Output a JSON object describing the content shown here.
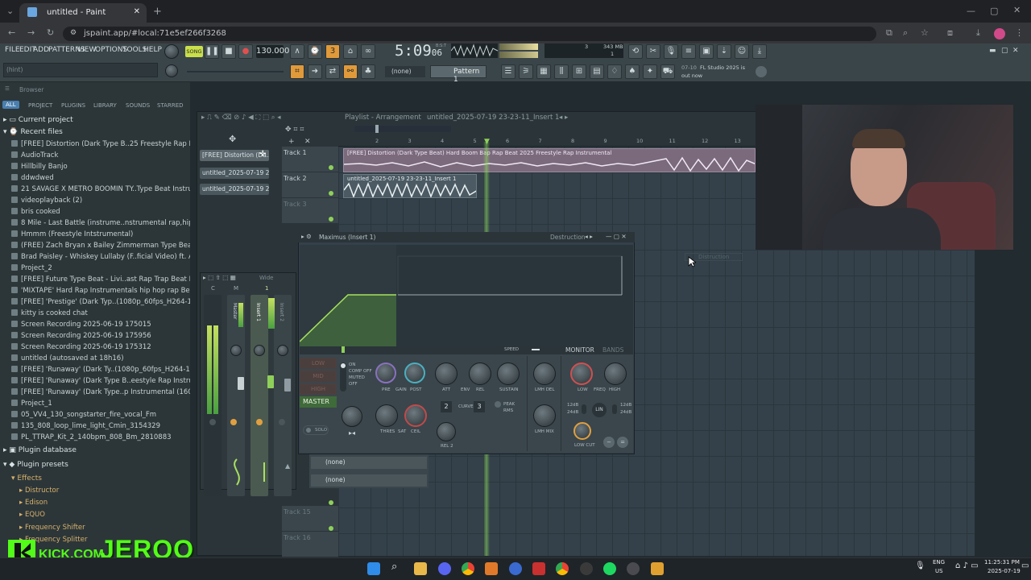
{
  "browser_tab": {
    "title": "untitled - Paint",
    "close": "✕",
    "new": "+"
  },
  "address": {
    "url": "jspaint.app/#local:71e5ef266f3268"
  },
  "menu": [
    "FILE",
    "EDIT",
    "ADD",
    "PATTERNS",
    "VIEW",
    "OPTIONS",
    "TOOLS",
    "HELP"
  ],
  "transport": {
    "song_label": "SONG",
    "tempo": "130.000",
    "time_main": "5:09",
    "time_sub": "06",
    "time_unit": "B:S:T",
    "cpu": "3",
    "mem": "343 MB",
    "voices": "1"
  },
  "hint": {
    "text": "(hint)",
    "news_date": "07-10",
    "news_text": "FL Studio 2025 is",
    "news_text2": "out now"
  },
  "pattern": {
    "selector": "(none)",
    "name": "Pattern 1"
  },
  "sidebar": {
    "browser_label": "Browser",
    "tabs": [
      "ALL",
      "PROJECT",
      "PLUGINS",
      "LIBRARY",
      "SOUNDS",
      "STARRED"
    ],
    "current_project": "Current project",
    "recent_files": "Recent files",
    "files": [
      "[FREE] Distortion (Dark Type B..25 Freestyle Rap Instrumental",
      "AudioTrack",
      "Hillbilly Banjo",
      "ddwdwed",
      "21 SAVAGE X METRO BOOMIN TY..Type Beat Instrumental 2025",
      "videoplayback (2)",
      "bris cooked",
      "8 Mile - Last Battle (instrume..nstrumental rap,hip hop beats)",
      "Hmmm (Freestyle Intstrumental)",
      "(FREE) Zach Bryan x Bailey Zimmerman Type Beat Too Late",
      "Brad Paisley - Whiskey Lullaby (F..ficial Video) ft. Alison Krauss",
      "Project_2",
      "[FREE] Future Type Beat - Livi..ast Rap Trap Beat Instrumental",
      "'MIXTAPE' Hard Rap Instrumentals  hip hop rap Beats [MIX]",
      "[FREE] 'Prestige' (Dark Typ..(1080p_60fps_H264-128kbit_AAC)",
      "kitty is cooked chat",
      "Screen Recording 2025-06-19 175015",
      "Screen Recording 2025-06-19 175956",
      "Screen Recording 2025-06-19 175312",
      "untitled (autosaved at 18h16)",
      "[FREE] 'Runaway' (Dark Ty..(1080p_60fps_H264-128kbit_AAC)",
      "[FREE] 'Runaway' (Dark Type B..eestyle Rap Instrumental (BQ)",
      "[FREE] 'Runaway' (Dark Type..p Instrumental (160kbit_Opus)",
      "Project_1",
      "05_VV4_130_songstarter_fire_vocal_Fm",
      "135_808_loop_lime_light_Cmin_3154329",
      "PL_TTRAP_Kit_2_140bpm_808_Bm_2810883"
    ],
    "plugin_database": "Plugin database",
    "plugin_presets": "Plugin presets",
    "effects": "Effects",
    "effect_items": [
      "Distructor",
      "Edison",
      "EQUO",
      "Frequency Shifter",
      "Frequency Splitter"
    ]
  },
  "playlist": {
    "title": "Playlist - Arrangement",
    "breadcrumb": "untitled_2025-07-19 23-23-11_Insert 1",
    "patterns": [
      "[FREE] Distortion (Da..",
      "untitled_2025-07-19 23-..",
      "untitled_2025-07-19 23-.."
    ],
    "tracks": [
      "Track 1",
      "Track 2",
      "Track 3",
      "Track 15",
      "Track 16"
    ],
    "clip1": "[FREE] Distortion (Dark Type Beat) Hard Boom Bap Rap Beat 2025 Freestyle Rap Instrumental",
    "clip2": "untitled_2025-07-19 23-23-11_Insert 1",
    "ruler": [
      "2",
      "3",
      "4",
      "5",
      "6",
      "7",
      "8",
      "9",
      "10",
      "11",
      "12",
      "13"
    ],
    "ghost": "Distruction"
  },
  "mixer": {
    "title": "Wide",
    "labels": [
      "C",
      "M",
      "1"
    ],
    "strips": [
      "Master",
      "Insert 1",
      "Insert 2"
    ],
    "slots": [
      "(none)",
      "(none)"
    ]
  },
  "maximus": {
    "title": "Maximus (Insert 1)",
    "preset": "Destruction",
    "speed": "SPEED",
    "monitor": "MONITOR",
    "bands_tab": "BANDS",
    "bands": [
      "LOW",
      "MID",
      "HIGH",
      "MASTER"
    ],
    "modes": [
      "ON",
      "COMP OFF",
      "MUTED",
      "OFF"
    ],
    "knob_labels": [
      "PRE",
      "GAIN",
      "POST",
      "ATT",
      "ENV",
      "REL",
      "SUSTAIN",
      "LMH DEL",
      "LOW",
      "FREQ",
      "HIGH",
      "THRES",
      "SAT",
      "CEIL",
      "REL 2",
      "LMH MIX",
      "LOW CUT"
    ],
    "curve_label": "CURVE",
    "curve_value": "3",
    "att_value": "2",
    "peak": "PEAK",
    "rms": "RMS",
    "solo": "SOLO",
    "lin": "LIN",
    "db_low": "12dB",
    "db_low2": "24dB",
    "db_high": "12dB",
    "db_high2": "24dB"
  },
  "kick": {
    "left": "KICK.COM",
    "right": "JERQO"
  },
  "taskbar": {
    "lang": "ENG",
    "region": "US",
    "time": "11:25:31 PM",
    "date": "2025-07-19"
  }
}
